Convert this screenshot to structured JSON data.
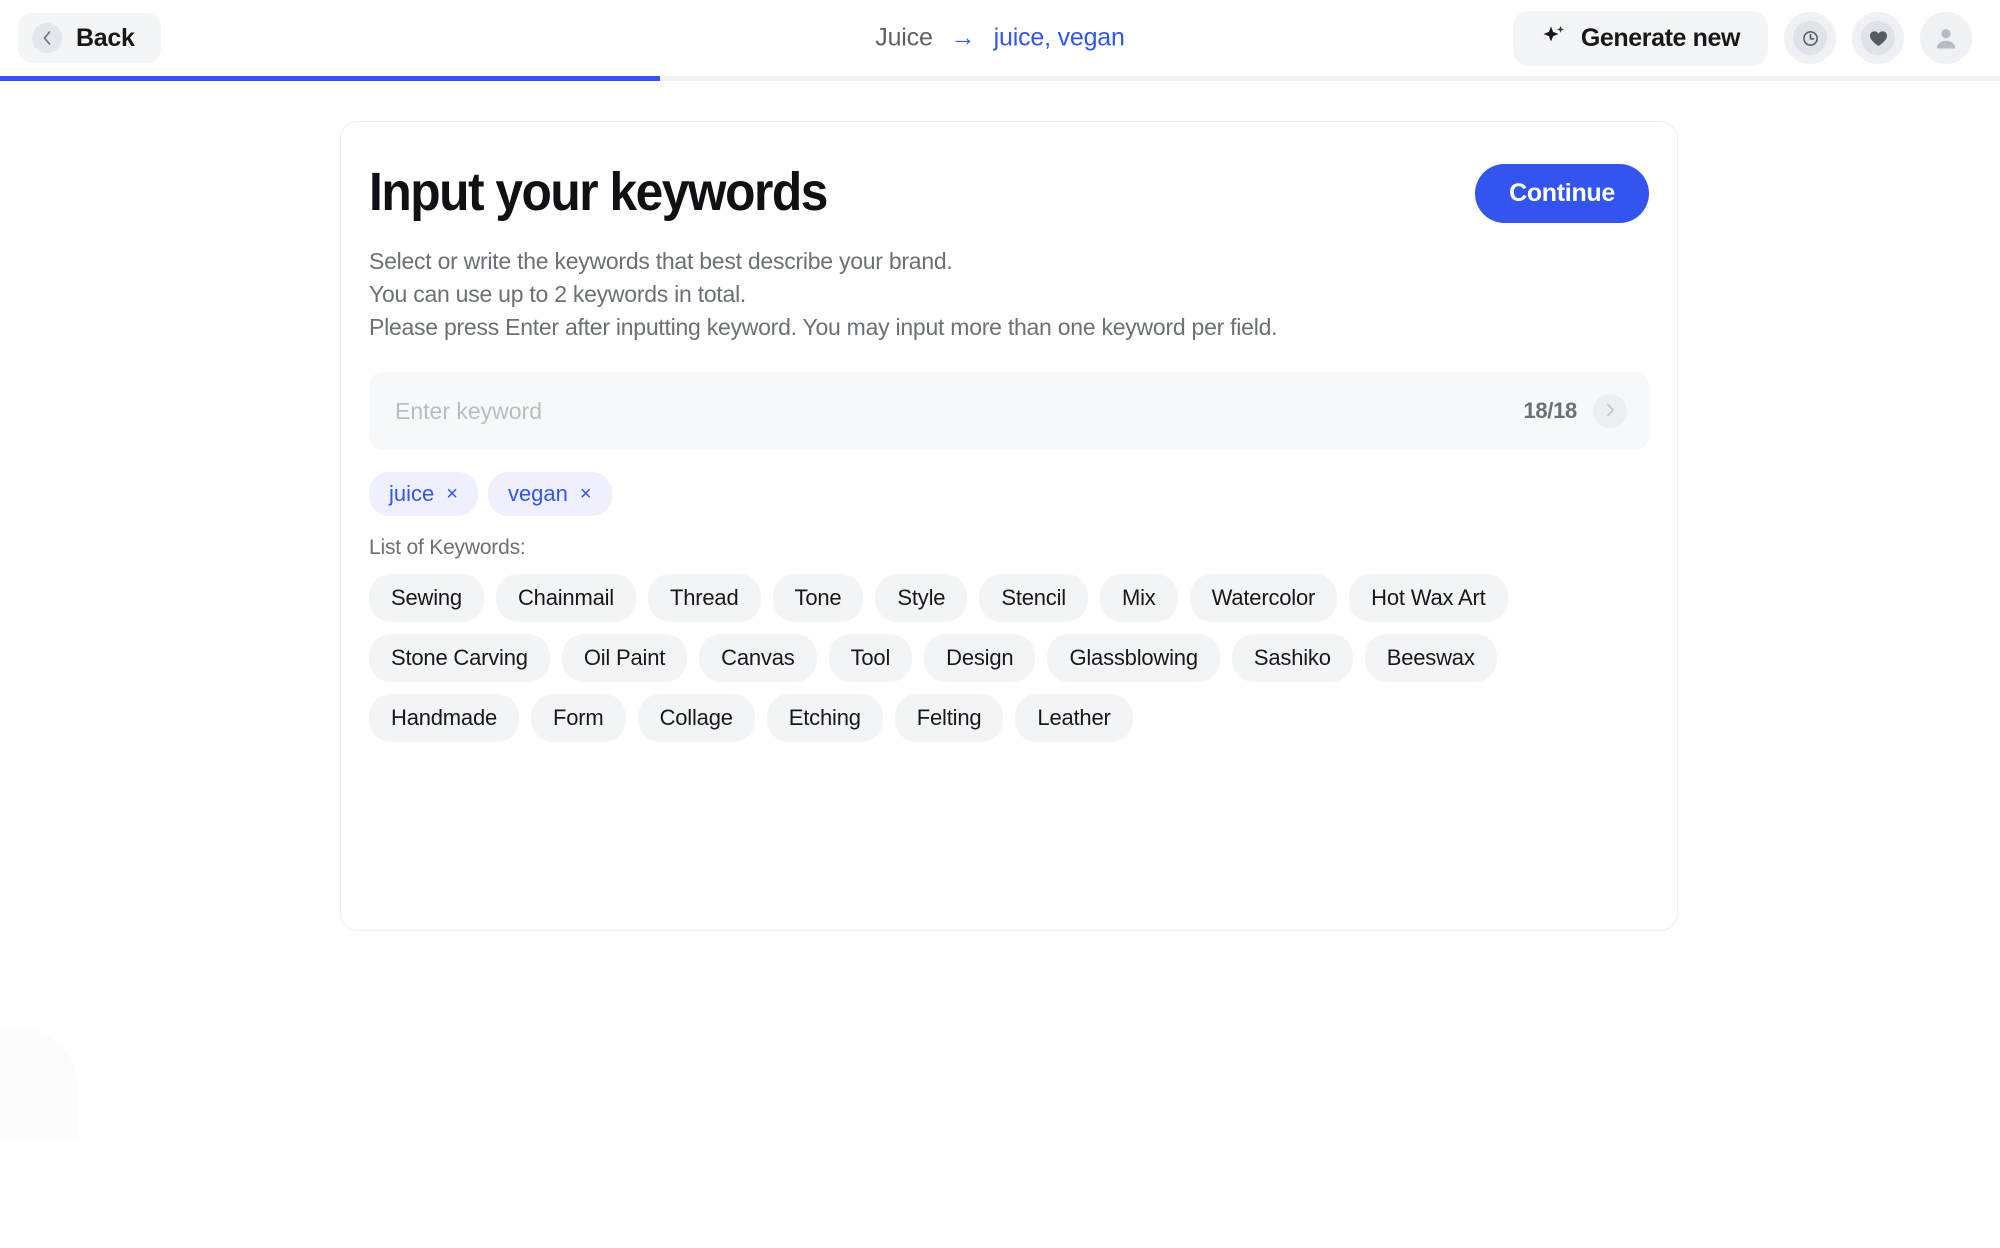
{
  "header": {
    "back_label": "Back",
    "back_icon": "chevron-left-icon",
    "breadcrumb": {
      "root": "Juice",
      "arrow": "→",
      "current": "juice, vegan"
    },
    "generate_label": "Generate new",
    "generate_icon": "sparkle-icon",
    "icons": [
      {
        "name": "history-icon",
        "glyph": "clock"
      },
      {
        "name": "favorites-icon",
        "glyph": "heart"
      },
      {
        "name": "account-icon",
        "glyph": "user"
      }
    ],
    "progress_percent": 33
  },
  "card": {
    "title": "Input your keywords",
    "continue_label": "Continue",
    "description": [
      "Select or write the keywords that best describe your brand.",
      "You can use up to 2 keywords in total.",
      "Please press Enter after inputting keyword. You may input more than one keyword per field."
    ],
    "input": {
      "value": "",
      "placeholder": "Enter keyword",
      "counter": "18/18",
      "submit_icon": "chevron-right-icon"
    },
    "selected_keywords": [
      {
        "label": "juice",
        "remove": "×"
      },
      {
        "label": "vegan",
        "remove": "×"
      }
    ],
    "list_label": "List of Keywords:",
    "keyword_options": [
      "Sewing",
      "Chainmail",
      "Thread",
      "Tone",
      "Style",
      "Stencil",
      "Mix",
      "Watercolor",
      "Hot Wax Art",
      "Stone Carving",
      "Oil Paint",
      "Canvas",
      "Tool",
      "Design",
      "Glassblowing",
      "Sashiko",
      "Beeswax",
      "Handmade",
      "Form",
      "Collage",
      "Etching",
      "Felting",
      "Leather"
    ]
  },
  "colors": {
    "accent": "#3355ee",
    "chip_bg": "#eef0fe",
    "tag_bg": "#f3f4f6",
    "text_muted": "#6b7076"
  }
}
